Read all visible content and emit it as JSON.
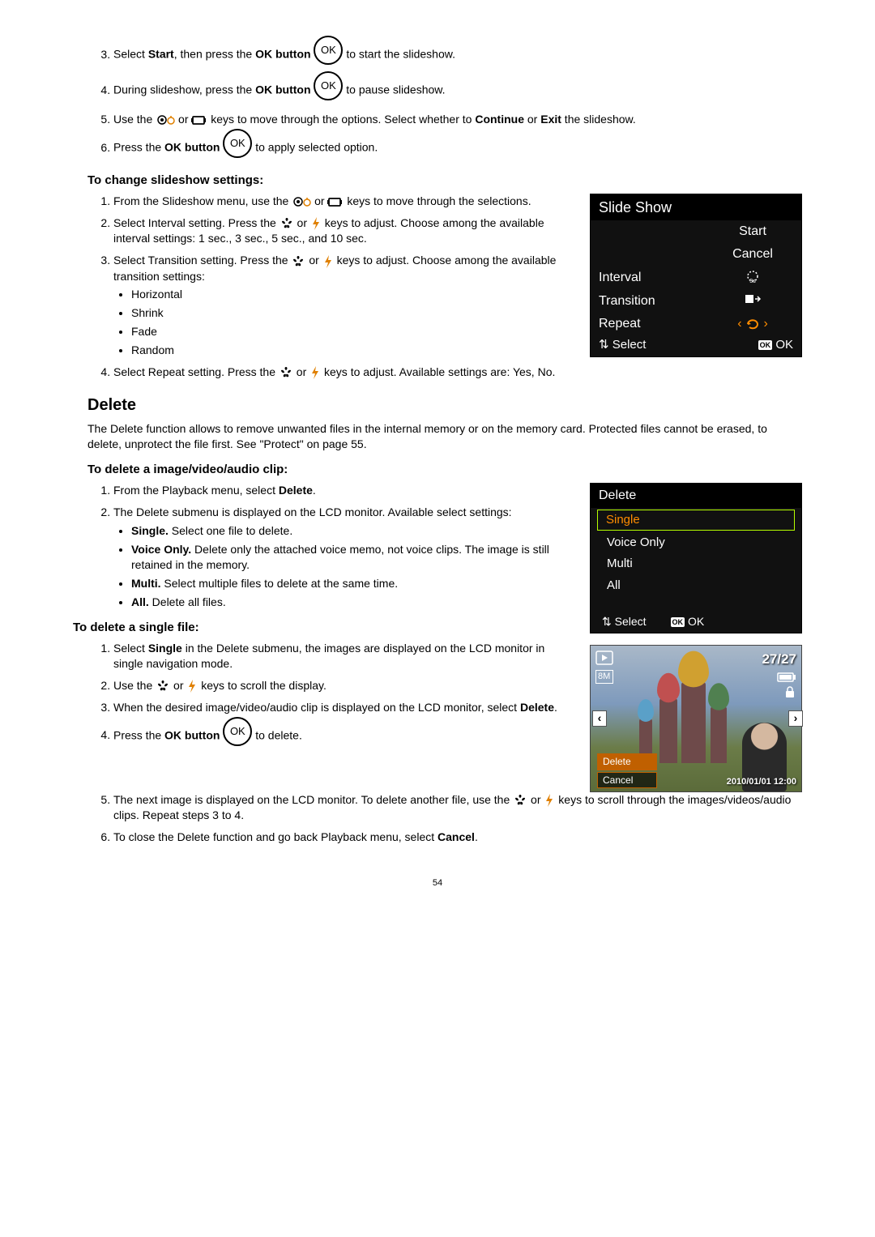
{
  "page_number": "54",
  "icons": {
    "ok": "OK",
    "ok_badge": "OK"
  },
  "steps_top": {
    "s3_a": "Select ",
    "s3_b": "Start",
    "s3_c": ", then press the ",
    "s3_d": "OK button",
    "s3_e": " to start the slideshow.",
    "s4_a": "During slideshow, press the ",
    "s4_b": "OK button",
    "s4_c": " to pause slideshow.",
    "s5_a": "Use the ",
    "s5_b": " or ",
    "s5_c": " keys to move through the options. Select whether to ",
    "s5_d": "Continue",
    "s5_e": " or ",
    "s5_f": "Exit",
    "s5_g": " the slideshow.",
    "s6_a": "Press the ",
    "s6_b": "OK button",
    "s6_c": " to apply selected option."
  },
  "subhead_change": "To change slideshow settings:",
  "change_steps": {
    "s1": "From the Slideshow menu, use the ",
    "s1b": " or ",
    "s1c": " keys to move through the selections.",
    "s2a": "Select Interval setting. Press the ",
    "s2b": " or ",
    "s2c": " keys to adjust. Choose among the available interval settings: 1 sec., 3 sec., 5 sec., and 10 sec.",
    "s3a": "Select Transition setting. Press the ",
    "s3b": " or ",
    "s3c": " keys to adjust. Choose among the available transition settings:",
    "ta": "Horizontal",
    "tb": "Shrink",
    "tc": "Fade",
    "td": "Random",
    "s4a": "Select Repeat setting. Press the ",
    "s4b": " or ",
    "s4c": " keys to adjust. Available settings are: Yes, No."
  },
  "slideshow_lcd": {
    "title": "Slide Show",
    "start": "Start",
    "cancel": "Cancel",
    "interval": "Interval",
    "transition": "Transition",
    "repeat": "Repeat",
    "select": "Select",
    "ok": "OK",
    "interval_icon": "3s"
  },
  "delete_section": {
    "head": "Delete",
    "intro": "The Delete function allows to remove unwanted files in the internal memory or on the memory card. Protected files cannot be erased, to delete, unprotect the file first. See \"Protect\" on page 55."
  },
  "subhead_delete_clip": "To delete a image/video/audio clip:",
  "delete_clip_steps": {
    "s1a": "From the Playback menu, select ",
    "s1b": "Delete",
    "s1c": ".",
    "s2": "The Delete submenu is displayed on the LCD monitor. Available select settings:",
    "oa_b": "Single.",
    "oa": " Select one file to delete.",
    "ob_b": "Voice Only.",
    "ob": " Delete only the attached voice memo, not voice clips. The image is still retained in the memory.",
    "oc_b": "Multi.",
    "oc": " Select multiple files to delete at the same time.",
    "od_b": "All.",
    "od": " Delete all files."
  },
  "delete_lcd": {
    "title": "Delete",
    "single": "Single",
    "voice": "Voice Only",
    "multi": "Multi",
    "all": "All",
    "select": "Select",
    "ok": "OK"
  },
  "subhead_delete_single": "To delete a single file:",
  "single_steps": {
    "s1a": "Select ",
    "s1b": "Single",
    "s1c": " in the Delete submenu, the images are displayed on the LCD monitor in single navigation mode.",
    "s2a": "Use the ",
    "s2b": " or ",
    "s2c": " keys to scroll the display.",
    "s3a": "When the desired image/video/audio clip is displayed on the LCD monitor, select ",
    "s3b": "Delete",
    "s3c": ".",
    "s4a": "Press the ",
    "s4b": "OK button",
    "s4c": " to delete.",
    "s5a": "The next image is displayed on the LCD monitor. To delete another file, use the ",
    "s5b": " or ",
    "s5c": " keys to scroll through the images/videos/audio clips. Repeat steps 3 to 4.",
    "s6a": "To close the Delete function and go back Playback menu, select ",
    "s6b": "Cancel",
    "s6c": "."
  },
  "photo_lcd": {
    "counter": "27/27",
    "size": "8M",
    "delete": "Delete",
    "cancel": "Cancel",
    "date": "2010/01/01 12:00"
  }
}
